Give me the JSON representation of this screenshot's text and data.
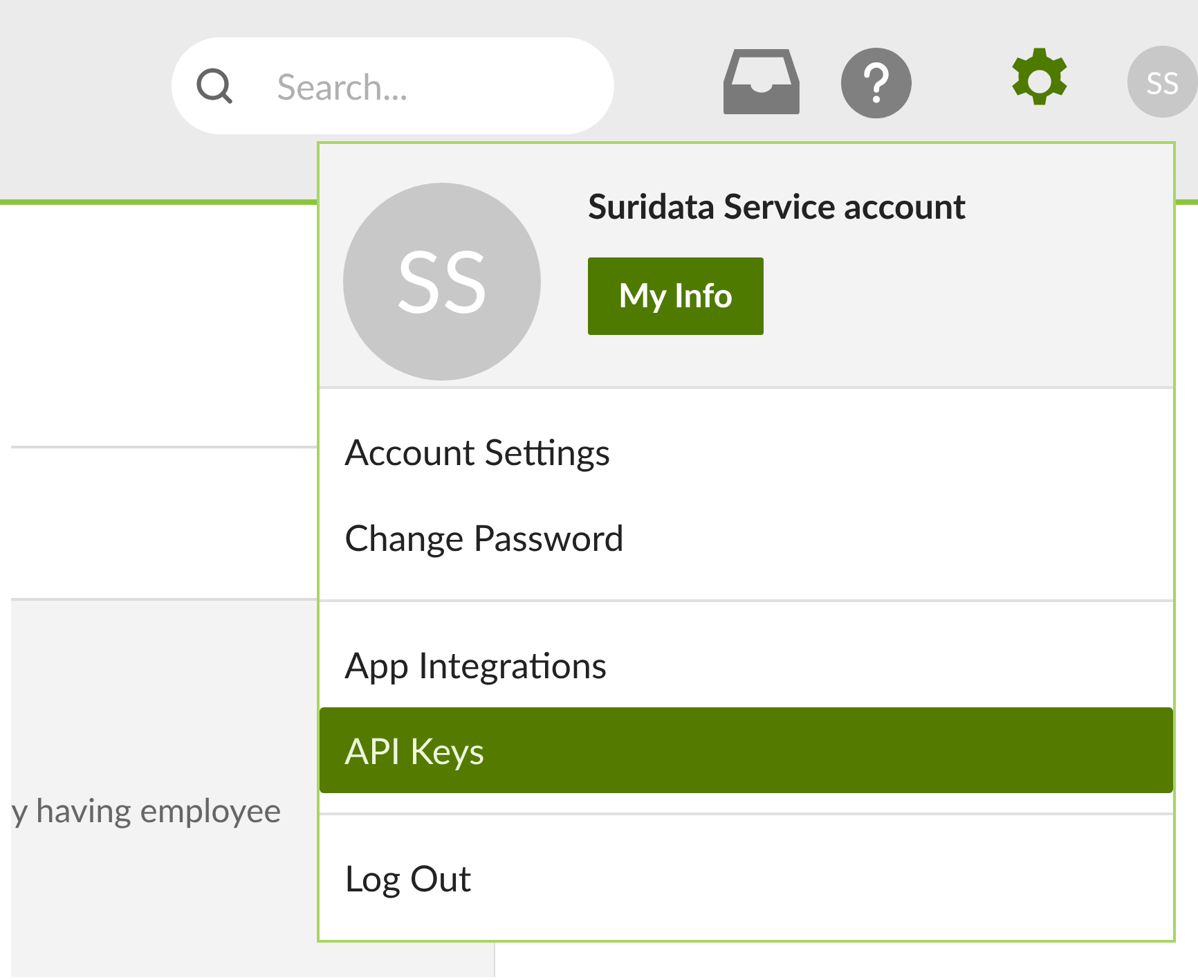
{
  "top_bar": {
    "search": {
      "placeholder": "Search..."
    },
    "avatar": {
      "initials": "SS"
    }
  },
  "content": {
    "text": "y having employee"
  },
  "user_menu": {
    "avatar": {
      "initials": "SS"
    },
    "name": "Suridata Service account",
    "my_info_button": "My Info",
    "groups": [
      [
        {
          "label": "Account Settings",
          "selected": false
        },
        {
          "label": "Change Password",
          "selected": false
        }
      ],
      [
        {
          "label": "App Integrations",
          "selected": false
        },
        {
          "label": "API Keys",
          "selected": true
        }
      ],
      [
        {
          "label": "Log Out",
          "selected": false
        }
      ]
    ]
  }
}
